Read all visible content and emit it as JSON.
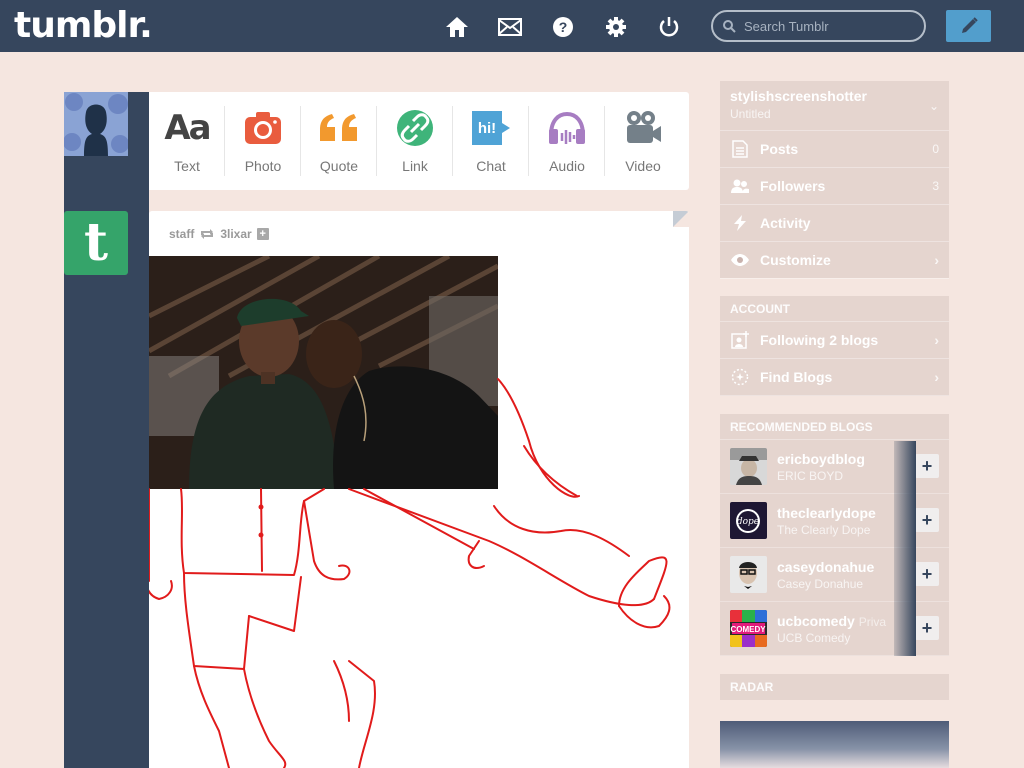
{
  "header": {
    "logo": "tumblr.",
    "search_placeholder": "Search Tumblr",
    "nav_icons": [
      "home-icon",
      "mail-icon",
      "help-icon",
      "gear-icon",
      "power-icon"
    ],
    "compose_icon": "pencil-icon"
  },
  "post_types": [
    {
      "label": "Text",
      "icon": "Aa",
      "color": "#444444"
    },
    {
      "label": "Photo",
      "icon": "camera-icon",
      "color": "#e95c3e"
    },
    {
      "label": "Quote",
      "icon": "quote-icon",
      "color": "#f2992e"
    },
    {
      "label": "Link",
      "icon": "link-icon",
      "color": "#3fb47a"
    },
    {
      "label": "Chat",
      "icon": "hi!",
      "color": "#4fa3d6"
    },
    {
      "label": "Audio",
      "icon": "headphones-icon",
      "color": "#a77dc2"
    },
    {
      "label": "Video",
      "icon": "video-camera-icon",
      "color": "#748089"
    }
  ],
  "post": {
    "author": "staff",
    "reblogged_from": "3lixar"
  },
  "sidebar": {
    "blog_name": "stylishscreenshotter",
    "blog_title": "Untitled",
    "items": [
      {
        "label": "Posts",
        "count": "0"
      },
      {
        "label": "Followers",
        "count": "3"
      },
      {
        "label": "Activity",
        "count": ""
      },
      {
        "label": "Customize",
        "count": ""
      }
    ],
    "account_title": "ACCOUNT",
    "account_items": [
      {
        "label": "Following 2 blogs"
      },
      {
        "label": "Find Blogs"
      }
    ],
    "recommended_title": "RECOMMENDED BLOGS",
    "recommended": [
      {
        "name": "ericboydblog",
        "sub": "ERIC BOYD"
      },
      {
        "name": "theclearlydope",
        "sub": "The Clearly Dope"
      },
      {
        "name": "caseydonahue",
        "sub": "Casey Donahue"
      },
      {
        "name": "ucbcomedy",
        "sub": "UCB Comedy",
        "extra": "Priva"
      }
    ],
    "radar_title": "RADAR"
  },
  "colors": {
    "navy": "#36465d",
    "background": "#f5e6e0",
    "compose": "#529ecc",
    "tumblr_green": "#35a46a",
    "drawing_red": "#e11b1b"
  }
}
